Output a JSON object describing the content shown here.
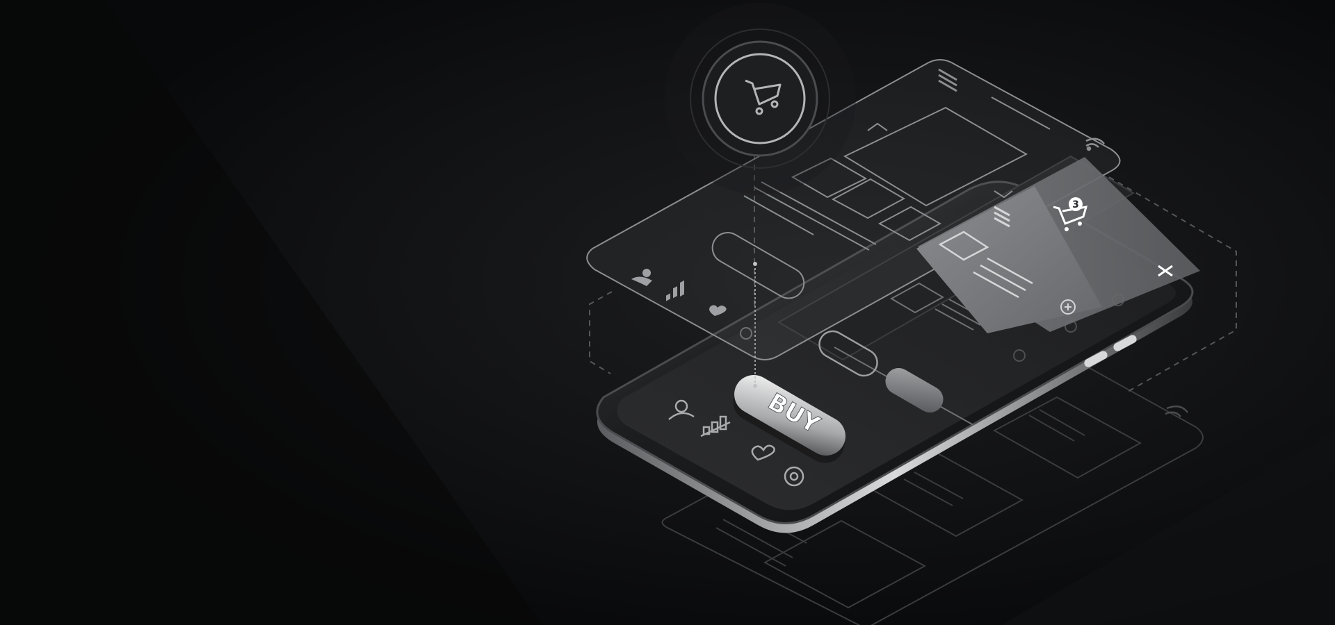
{
  "scene": {
    "buy_label": "BUY",
    "cart_count": "3",
    "close_glyph": "×",
    "icons": {
      "cart": "shopping-cart-icon",
      "cart_badge": "cart-with-badge-icon",
      "menu": "hamburger-menu-icon",
      "wifi": "wifi-icon",
      "user": "user-icon",
      "chart": "bar-chart-icon",
      "heart": "heart-icon",
      "settings": "gear-icon",
      "close": "close-icon",
      "plus": "plus-circle-icon"
    }
  },
  "colors": {
    "background": "#0b0c0d",
    "phone_body": "#1b1c1e",
    "screen": "#2a2b2d",
    "wireframe": "#8a8d90",
    "button_glow": "#e6e6e6",
    "panel": "#6e7073"
  }
}
